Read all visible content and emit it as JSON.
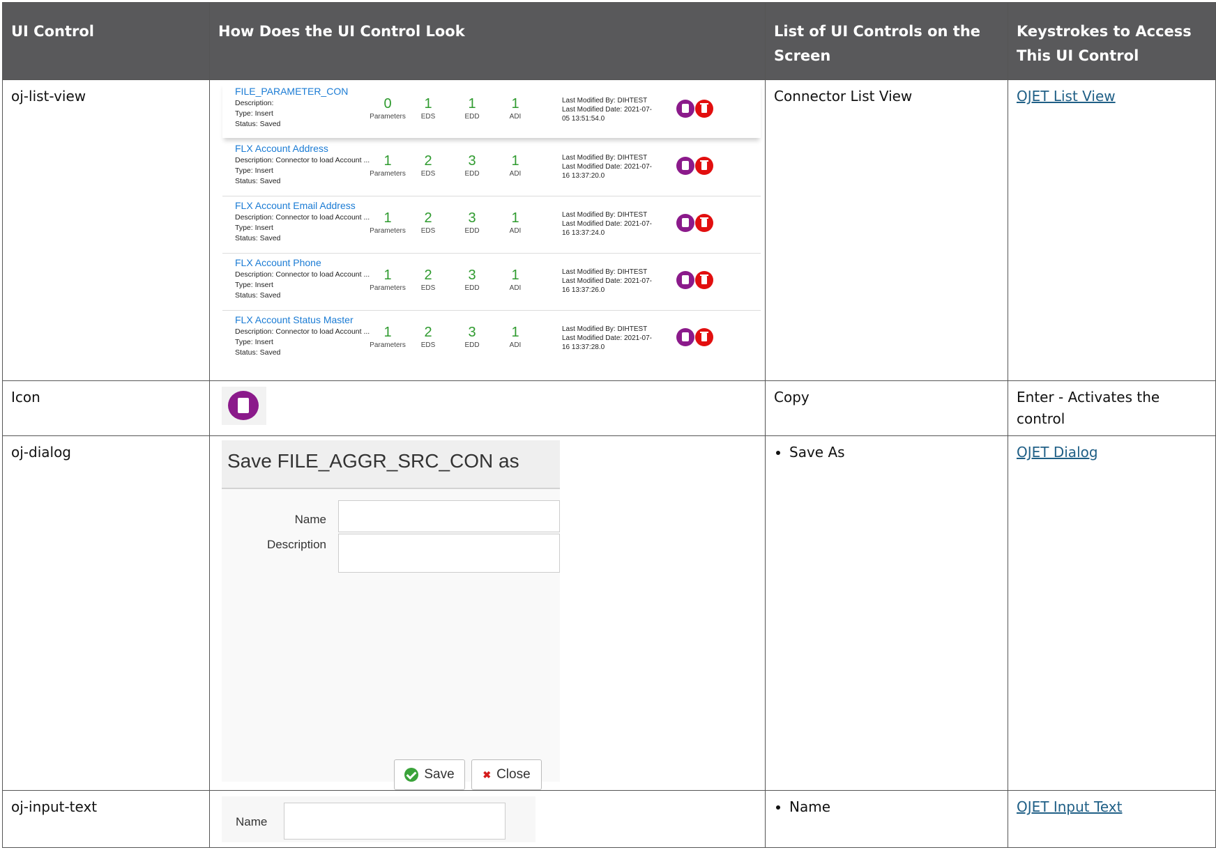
{
  "headers": [
    "UI Control",
    "How Does the UI Control Look",
    "List of UI Controls on the Screen",
    "Keystrokes to Access This UI Control"
  ],
  "rows": [
    {
      "control": "oj-list-view",
      "screen_controls": "Connector List View",
      "keystroke_link": "OJET List View"
    },
    {
      "control": "Icon",
      "screen_controls": "Copy",
      "keystroke_text": "Enter - Activates the control"
    },
    {
      "control": "oj-dialog",
      "screen_controls": "Save As",
      "keystroke_link": "OJET Dialog"
    },
    {
      "control": "oj-input-text",
      "screen_controls": "Name",
      "keystroke_link": "OJET Input Text"
    }
  ],
  "list_view": {
    "labels": {
      "description": "Description:",
      "type": "Type:",
      "status": "Status:",
      "parameters": "Parameters",
      "eds": "EDS",
      "edd": "EDD",
      "adi": "ADI",
      "modified_by": "Last Modified By:",
      "modified_date": "Last Modified Date:"
    },
    "items": [
      {
        "name": "FILE_PARAMETER_CON",
        "description": "",
        "type": "Insert",
        "status": "Saved",
        "parameters": "0",
        "eds": "1",
        "edd": "1",
        "adi": "1",
        "modified_by": "DIHTEST",
        "date_part1": "2021-07-",
        "date_part2": "05 13:51:54.0"
      },
      {
        "name": "FLX Account Address",
        "description": "Connector to load Account ...",
        "type": "Insert",
        "status": "Saved",
        "parameters": "1",
        "eds": "2",
        "edd": "3",
        "adi": "1",
        "modified_by": "DIHTEST",
        "date_part1": "2021-07-",
        "date_part2": "16 13:37:20.0"
      },
      {
        "name": "FLX Account Email Address",
        "description": "Connector to load Account ...",
        "type": "Insert",
        "status": "Saved",
        "parameters": "1",
        "eds": "2",
        "edd": "3",
        "adi": "1",
        "modified_by": "DIHTEST",
        "date_part1": "2021-07-",
        "date_part2": "16 13:37:24.0"
      },
      {
        "name": "FLX Account Phone",
        "description": "Connector to load Account ...",
        "type": "Insert",
        "status": "Saved",
        "parameters": "1",
        "eds": "2",
        "edd": "3",
        "adi": "1",
        "modified_by": "DIHTEST",
        "date_part1": "2021-07-",
        "date_part2": "16 13:37:26.0"
      },
      {
        "name": "FLX Account Status Master",
        "description": "Connector to load Account ...",
        "type": "Insert",
        "status": "Saved",
        "parameters": "1",
        "eds": "2",
        "edd": "3",
        "adi": "1",
        "modified_by": "DIHTEST",
        "date_part1": "2021-07-",
        "date_part2": "16 13:37:28.0"
      }
    ]
  },
  "dialog": {
    "title": "Save FILE_AGGR_SRC_CON as",
    "name_label": "Name",
    "description_label": "Description",
    "save_label": "Save",
    "close_label": "Close"
  },
  "input_text": {
    "label": "Name"
  },
  "colors": {
    "header_bg": "#59595b",
    "link": "#1f5f86",
    "copy_icon": "#8b1a8b",
    "delete_icon": "#e20f0f",
    "count_green": "#2e9a2e",
    "item_link": "#1a7bd4"
  },
  "icons": [
    "copy-icon",
    "delete-icon",
    "check-icon",
    "close-x-icon"
  ]
}
